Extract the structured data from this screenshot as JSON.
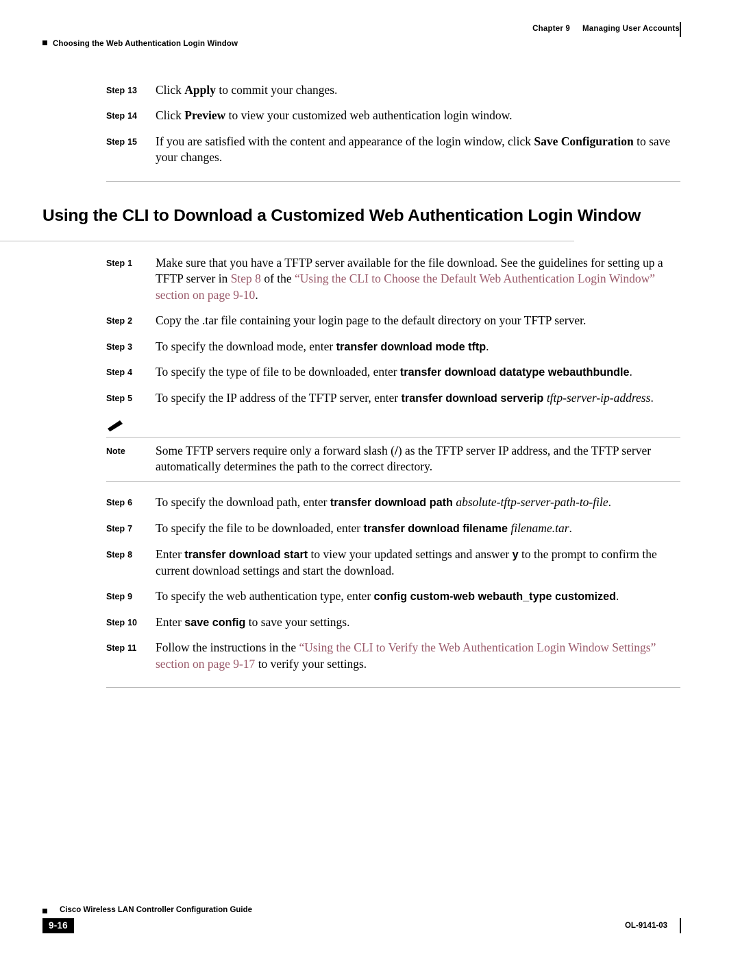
{
  "header": {
    "chapter_label": "Chapter 9",
    "chapter_title": "Managing User Accounts",
    "running_head": "Choosing the Web Authentication Login Window"
  },
  "top_steps": [
    {
      "label": "Step",
      "number": "13",
      "text_parts": [
        {
          "t": "Click ",
          "style": "normal"
        },
        {
          "t": "Apply",
          "style": "bold"
        },
        {
          "t": " to commit your changes.",
          "style": "normal"
        }
      ]
    },
    {
      "label": "Step",
      "number": "14",
      "text_parts": [
        {
          "t": "Click ",
          "style": "normal"
        },
        {
          "t": "Preview",
          "style": "bold"
        },
        {
          "t": " to view your customized web authentication login window.",
          "style": "normal"
        }
      ]
    },
    {
      "label": "Step",
      "number": "15",
      "text_parts": [
        {
          "t": "If you are satisfied with the content and appearance of the login window, click ",
          "style": "normal"
        },
        {
          "t": "Save Configuration",
          "style": "bold"
        },
        {
          "t": " to save your changes.",
          "style": "normal"
        }
      ]
    }
  ],
  "section": {
    "title": "Using the CLI to Download a Customized Web Authentication Login Window"
  },
  "cli_steps": [
    {
      "label": "Step",
      "number": "1",
      "text_parts": [
        {
          "t": "Make sure that you have a TFTP server available for the file download. See the guidelines for setting up a TFTP server in ",
          "style": "normal"
        },
        {
          "t": "Step 8",
          "style": "xref"
        },
        {
          "t": " of the ",
          "style": "normal"
        },
        {
          "t": "“Using the CLI to Choose the Default Web Authentication Login Window” section on page 9-10",
          "style": "xref"
        },
        {
          "t": ".",
          "style": "normal"
        }
      ]
    },
    {
      "label": "Step",
      "number": "2",
      "text_parts": [
        {
          "t": "Copy the .tar file containing your login page to the default directory on your TFTP server.",
          "style": "normal"
        }
      ]
    },
    {
      "label": "Step",
      "number": "3",
      "text_parts": [
        {
          "t": "To specify the download mode, enter ",
          "style": "normal"
        },
        {
          "t": "transfer download mode tftp",
          "style": "sansbold"
        },
        {
          "t": ".",
          "style": "normal"
        }
      ]
    },
    {
      "label": "Step",
      "number": "4",
      "text_parts": [
        {
          "t": "To specify the type of file to be downloaded, enter ",
          "style": "normal"
        },
        {
          "t": "transfer download datatype webauthbundle",
          "style": "sansbold"
        },
        {
          "t": ".",
          "style": "normal"
        }
      ]
    },
    {
      "label": "Step",
      "number": "5",
      "text_parts": [
        {
          "t": "To specify the IP address of the TFTP server, enter ",
          "style": "normal"
        },
        {
          "t": "transfer download serverip ",
          "style": "sansbold"
        },
        {
          "t": "tftp-server-ip-address",
          "style": "italic"
        },
        {
          "t": ".",
          "style": "normal"
        }
      ]
    }
  ],
  "note": {
    "icon": "✎",
    "label": "Note",
    "text_parts": [
      {
        "t": "Some TFTP servers require only a forward slash (",
        "style": "normal"
      },
      {
        "t": "/",
        "style": "bold"
      },
      {
        "t": ") as the TFTP server IP address, and the TFTP server automatically determines the path to the correct directory.",
        "style": "normal"
      }
    ]
  },
  "cli_steps_2": [
    {
      "label": "Step",
      "number": "6",
      "text_parts": [
        {
          "t": "To specify the download path, enter ",
          "style": "normal"
        },
        {
          "t": "transfer download path ",
          "style": "sansbold"
        },
        {
          "t": "absolute-tftp-server-path-to-file",
          "style": "italic"
        },
        {
          "t": ".",
          "style": "normal"
        }
      ]
    },
    {
      "label": "Step",
      "number": "7",
      "text_parts": [
        {
          "t": "To specify the file to be downloaded, enter ",
          "style": "normal"
        },
        {
          "t": "transfer download filename ",
          "style": "sansbold"
        },
        {
          "t": "filename.tar",
          "style": "italic"
        },
        {
          "t": ".",
          "style": "normal"
        }
      ]
    },
    {
      "label": "Step",
      "number": "8",
      "text_parts": [
        {
          "t": "Enter ",
          "style": "normal"
        },
        {
          "t": "transfer download start",
          "style": "sansbold"
        },
        {
          "t": " to view your updated settings and answer ",
          "style": "normal"
        },
        {
          "t": "y",
          "style": "sansbold"
        },
        {
          "t": " to the prompt to confirm the current download settings and start the download.",
          "style": "normal"
        }
      ]
    },
    {
      "label": "Step",
      "number": "9",
      "text_parts": [
        {
          "t": "To specify the web authentication type, enter ",
          "style": "normal"
        },
        {
          "t": "config custom-web webauth_type customized",
          "style": "sansbold"
        },
        {
          "t": ".",
          "style": "normal"
        }
      ]
    },
    {
      "label": "Step",
      "number": "10",
      "text_parts": [
        {
          "t": "Enter ",
          "style": "normal"
        },
        {
          "t": "save config",
          "style": "sansbold"
        },
        {
          "t": " to save your settings.",
          "style": "normal"
        }
      ]
    },
    {
      "label": "Step",
      "number": "11",
      "text_parts": [
        {
          "t": "Follow the instructions in the ",
          "style": "normal"
        },
        {
          "t": "“Using the CLI to Verify the Web Authentication Login Window Settings” section on page 9-17",
          "style": "xref"
        },
        {
          "t": " to verify your settings.",
          "style": "normal"
        }
      ]
    }
  ],
  "footer": {
    "doc_title": "Cisco Wireless LAN Controller Configuration Guide",
    "page_number": "9-16",
    "doc_id": "OL-9141-03"
  }
}
